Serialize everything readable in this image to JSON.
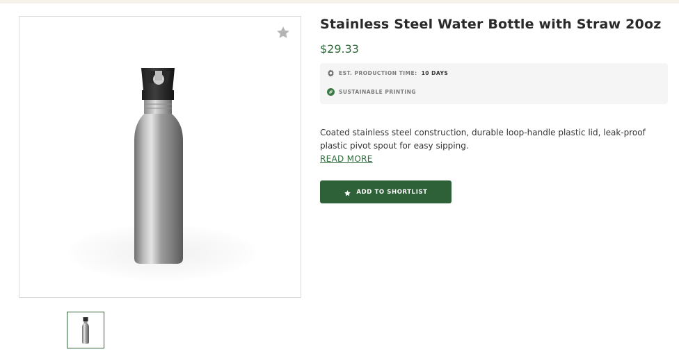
{
  "product": {
    "title": "Stainless Steel Water Bottle with Straw 20oz",
    "price": "$29.33",
    "production_label": "EST. PRODUCTION TIME:",
    "production_value": "10 DAYS",
    "sustainable_label": "SUSTAINABLE PRINTING",
    "description": "Coated stainless steel construction, durable loop-handle plastic lid, leak-proof plastic pivot spout for easy sipping.",
    "read_more": "READ MORE"
  },
  "actions": {
    "shortlist_label": "ADD TO SHORTLIST"
  },
  "icons": {
    "favorite": "star-icon",
    "production": "gear-icon",
    "sustainable": "leaf-icon",
    "shortlist": "star-icon"
  },
  "colors": {
    "accent": "#2e6138",
    "price": "#2e6b3a",
    "info_bg": "#f5f5f5",
    "top_strip": "#f6f1ea"
  }
}
